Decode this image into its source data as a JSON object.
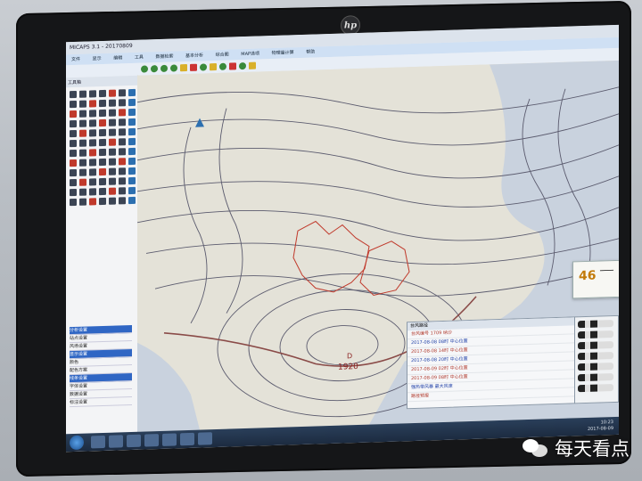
{
  "app": {
    "title": "MICAPS 3.1 - 20170809"
  },
  "menu": [
    "文件",
    "显示",
    "编辑",
    "工具",
    "数据检索",
    "基本分析",
    "综合图",
    "MAP选项",
    "物理量计算",
    "帮助"
  ],
  "map": {
    "low_label": "D",
    "low_value": "1920",
    "popup_value": "46",
    "popup_button": "确定"
  },
  "left_panel": {
    "header": "工具箱",
    "list": [
      "分析设置",
      "站点设置",
      "风场设置",
      "显示设置",
      "颜色",
      "配色方案",
      "线条设置",
      "字体设置",
      "数据设置",
      "标注设置"
    ]
  },
  "dialog": {
    "header": "台风路径",
    "rows": [
      "台风编号 1709 纳沙",
      "2017-08-08 08时 中心位置",
      "2017-08-08 14时 中心位置",
      "2017-08-08 20时 中心位置",
      "2017-08-09 02时 中心位置",
      "2017-08-09 08时 中心位置",
      "强热带风暴 最大风速",
      "路径预报"
    ]
  },
  "clock": {
    "time": "10:23",
    "date": "2017-08-09"
  },
  "watermark": {
    "text": "每天看点"
  },
  "colors": {
    "map_land": "#e4e2d8",
    "map_sea": "#c9d2de",
    "isobar": "#5b5b6e",
    "province_border": "#c0392b",
    "front_line": "#8a4b48"
  }
}
